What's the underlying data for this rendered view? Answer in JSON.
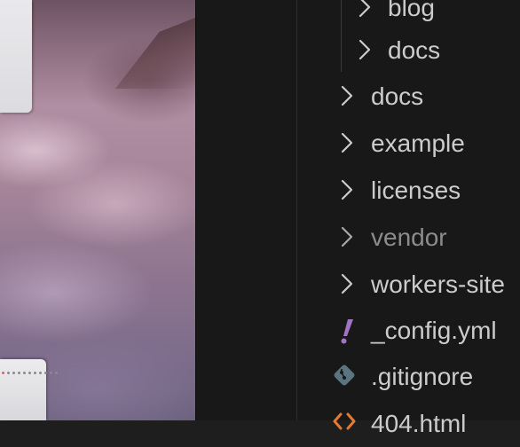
{
  "explorer": {
    "items": [
      {
        "label": "blog",
        "type": "folder",
        "nested": true
      },
      {
        "label": "docs",
        "type": "folder",
        "nested": true
      },
      {
        "label": "docs",
        "type": "folder"
      },
      {
        "label": "example",
        "type": "folder"
      },
      {
        "label": "licenses",
        "type": "folder"
      },
      {
        "label": "vendor",
        "type": "folder",
        "ignored": true
      },
      {
        "label": "workers-site",
        "type": "folder"
      },
      {
        "label": "_config.yml",
        "type": "file",
        "icon": "exclamation-icon"
      },
      {
        "label": ".gitignore",
        "type": "file",
        "icon": "git-icon"
      },
      {
        "label": "404.html",
        "type": "file",
        "icon": "html-icon"
      }
    ]
  },
  "colors": {
    "sidebar_bg": "#181818",
    "text": "#cccccc",
    "ignored_text": "#8c8c8c",
    "yaml_icon": "#a074c4",
    "git_icon": "#41535b",
    "html_icon": "#e37933"
  }
}
